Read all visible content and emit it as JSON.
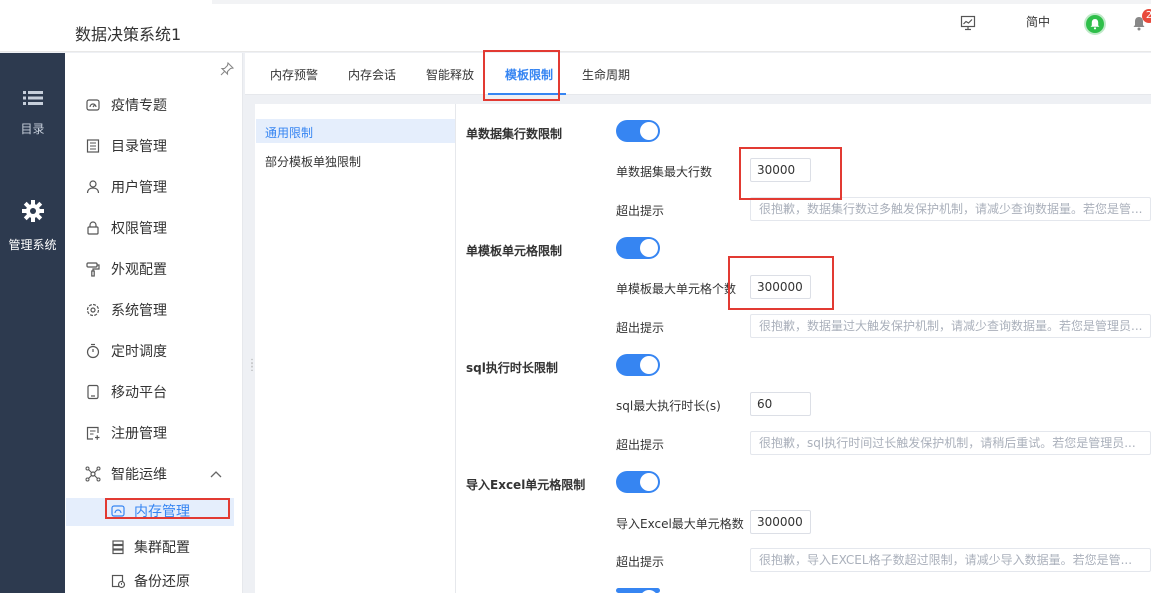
{
  "app": {
    "title": "数据决策系统1"
  },
  "header": {
    "lang_label": "简中",
    "notification_count": "2"
  },
  "rail": [
    {
      "label": "目录",
      "icon": "list-icon"
    },
    {
      "label": "管理系统",
      "icon": "gear-icon"
    }
  ],
  "sidebar": {
    "items": [
      {
        "label": "疫情专题",
        "icon": "dashboard-icon"
      },
      {
        "label": "目录管理",
        "icon": "catalog-icon"
      },
      {
        "label": "用户管理",
        "icon": "user-icon"
      },
      {
        "label": "权限管理",
        "icon": "lock-icon"
      },
      {
        "label": "外观配置",
        "icon": "paint-roller-icon"
      },
      {
        "label": "系统管理",
        "icon": "settings-icon"
      },
      {
        "label": "定时调度",
        "icon": "timer-icon"
      },
      {
        "label": "移动平台",
        "icon": "tablet-icon"
      },
      {
        "label": "注册管理",
        "icon": "register-icon"
      },
      {
        "label": "智能运维",
        "icon": "network-icon"
      }
    ],
    "sub_items": [
      {
        "label": "内存管理",
        "icon": "memory-icon"
      },
      {
        "label": "集群配置",
        "icon": "server-icon"
      },
      {
        "label": "备份还原",
        "icon": "backup-icon"
      }
    ]
  },
  "tabs": [
    "内存预警",
    "内存会话",
    "智能释放",
    "模板限制",
    "生命周期"
  ],
  "subnav": [
    "通用限制",
    "部分模板单独限制"
  ],
  "sections": [
    {
      "title": "单数据集行数限制",
      "field_label": "单数据集最大行数",
      "value": "30000",
      "tip_label": "超出提示",
      "tip": "很抱歉，数据集行数过多触发保护机制，请减少查询数据量。若您是管..."
    },
    {
      "title": "单模板单元格限制",
      "field_label": "单模板最大单元格个数",
      "value": "300000",
      "tip_label": "超出提示",
      "tip": "很抱歉，数据量过大触发保护机制，请减少查询数据量。若您是管理员..."
    },
    {
      "title": "sql执行时长限制",
      "field_label": "sql最大执行时长(s)",
      "value": "60",
      "tip_label": "超出提示",
      "tip": "很抱歉，sql执行时间过长触发保护机制，请稍后重试。若您是管理员..."
    },
    {
      "title": "导入Excel单元格限制",
      "field_label": "导入Excel最大单元格数",
      "value": "300000",
      "tip_label": "超出提示",
      "tip": "很抱歉，导入EXCEL格子数超过限制，请减少导入数据量。若您是管..."
    }
  ],
  "colors": {
    "accent": "#3685f2",
    "rail_bg": "#2d3a4f",
    "highlight": "#e23a32",
    "avatar": "#2fbf4a"
  }
}
